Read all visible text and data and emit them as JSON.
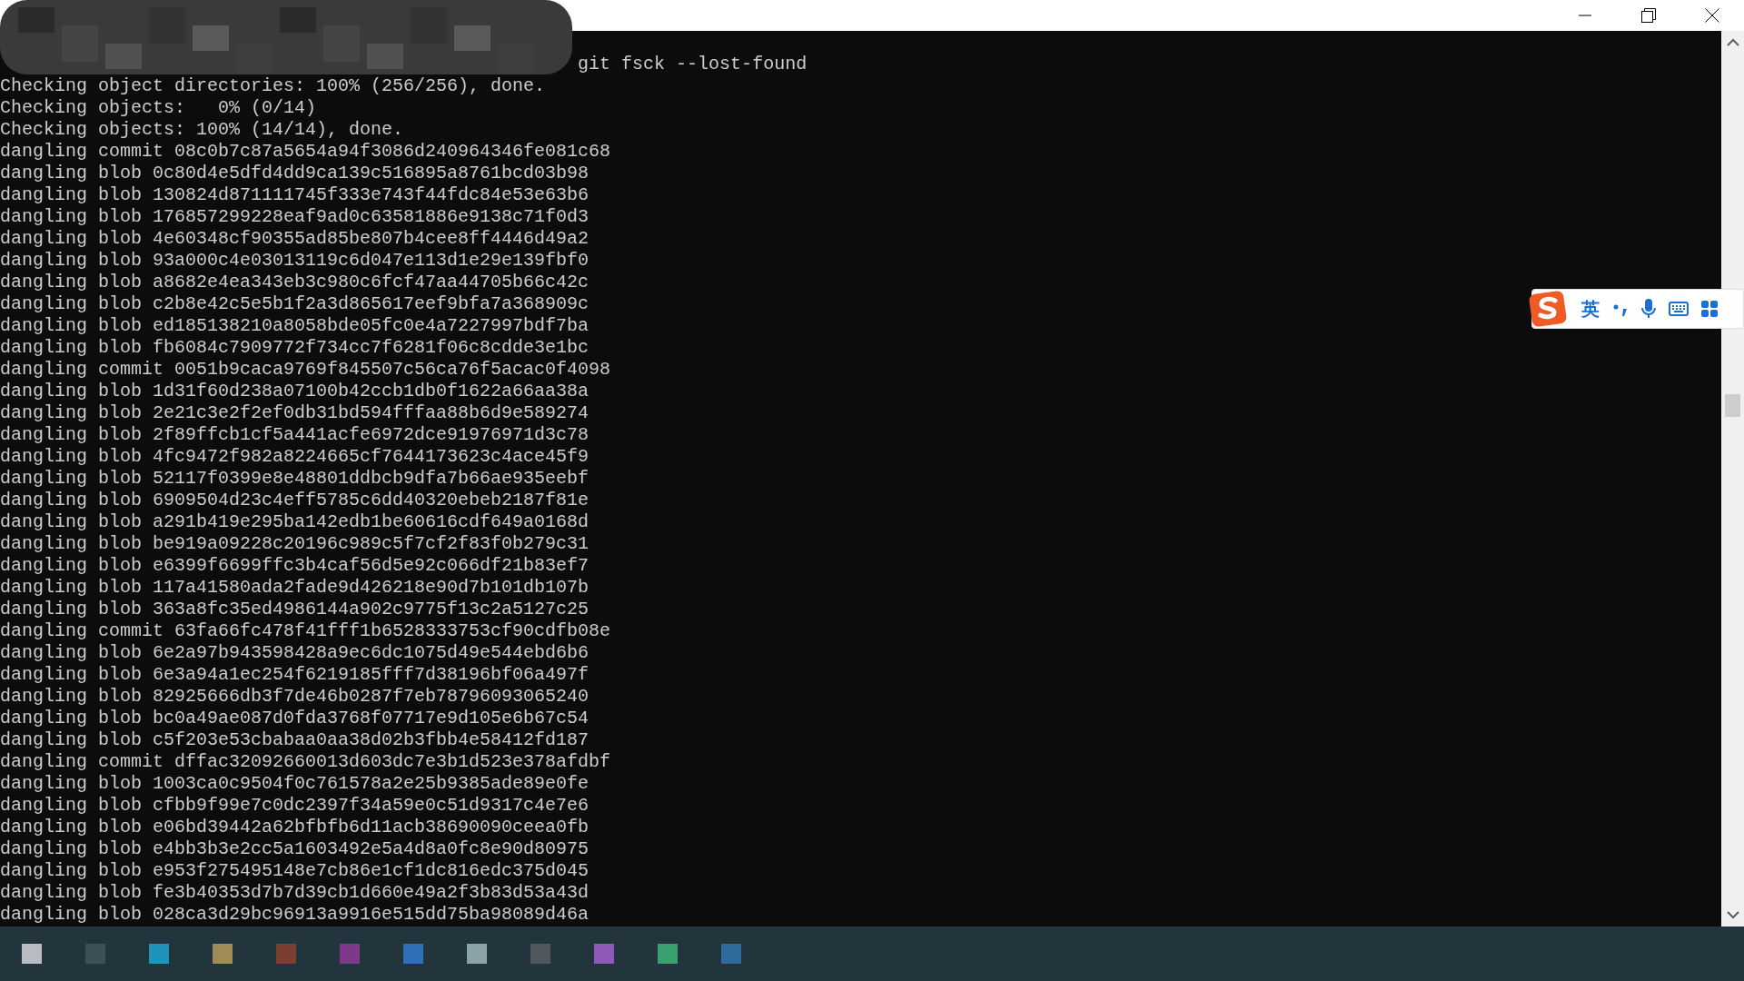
{
  "terminal": {
    "command": "git fsck --lost-found",
    "lines": [
      "Checking object directories: 100% (256/256), done.",
      "Checking objects:   0% (0/14)",
      "Checking objects: 100% (14/14), done.",
      "dangling commit 08c0b7c87a5654a94f3086d240964346fe081c68",
      "dangling blob 0c80d4e5dfd4dd9ca139c516895a8761bcd03b98",
      "dangling blob 130824d871111745f333e743f44fdc84e53e63b6",
      "dangling blob 176857299228eaf9ad0c63581886e9138c71f0d3",
      "dangling blob 4e60348cf90355ad85be807b4cee8ff4446d49a2",
      "dangling blob 93a000c4e03013119c6d047e113d1e29e139fbf0",
      "dangling blob a8682e4ea343eb3c980c6fcf47aa44705b66c42c",
      "dangling blob c2b8e42c5e5b1f2a3d865617eef9bfa7a368909c",
      "dangling blob ed185138210a8058bde05fc0e4a7227997bdf7ba",
      "dangling blob fb6084c7909772f734cc7f6281f06c8cdde3e1bc",
      "dangling commit 0051b9caca9769f845507c56ca76f5acac0f4098",
      "dangling blob 1d31f60d238a07100b42ccb1db0f1622a66aa38a",
      "dangling blob 2e21c3e2f2ef0db31bd594fffaa88b6d9e589274",
      "dangling blob 2f89ffcb1cf5a441acfe6972dce91976971d3c78",
      "dangling blob 4fc9472f982a8224665cf7644173623c4ace45f9",
      "dangling blob 52117f0399e8e48801ddbcb9dfa7b66ae935eebf",
      "dangling blob 6909504d23c4eff5785c6dd40320ebeb2187f81e",
      "dangling blob a291b419e295ba142edb1be60616cdf649a0168d",
      "dangling blob be919a09228c20196c989c5f7cf2f83f0b279c31",
      "dangling blob e6399f6699ffc3b4caf56d5e92c066df21b83ef7",
      "dangling blob 117a41580ada2fade9d426218e90d7b101db107b",
      "dangling blob 363a8fc35ed4986144a902c9775f13c2a5127c25",
      "dangling commit 63fa66fc478f41fff1b6528333753cf90cdfb08e",
      "dangling blob 6e2a97b943598428a9ec6dc1075d49e544ebd6b6",
      "dangling blob 6e3a94a1ec254f6219185fff7d38196bf06a497f",
      "dangling blob 82925666db3f7de46b0287f7eb78796093065240",
      "dangling blob bc0a49ae087d0fda3768f07717e9d105e6b67c54",
      "dangling blob c5f203e53cbabaa0aa38d02b3fbb4e58412fd187",
      "dangling commit dffac32092660013d603dc7e3b1d523e378afdbf",
      "dangling blob 1003ca0c9504f0c761578a2e25b9385ade89e0fe",
      "dangling blob cfbb9f99e7c0dc2397f34a59e0c51d9317c4e7e6",
      "dangling blob e06bd39442a62bfbfb6d11acb38690090ceea0fb",
      "dangling blob e4bb3b3e2cc5a1603492e5a4d8a0fc8e90d80975",
      "dangling blob e953f275495148e7cb86e1cf1dc816edc375d045",
      "dangling blob fe3b40353d7b7d39cb1d660e49a2f3b83d53a43d",
      "dangling blob 028ca3d29bc96913a9916e515dd75ba98089d46a"
    ]
  },
  "ime_toolbar": {
    "mode": "英"
  }
}
